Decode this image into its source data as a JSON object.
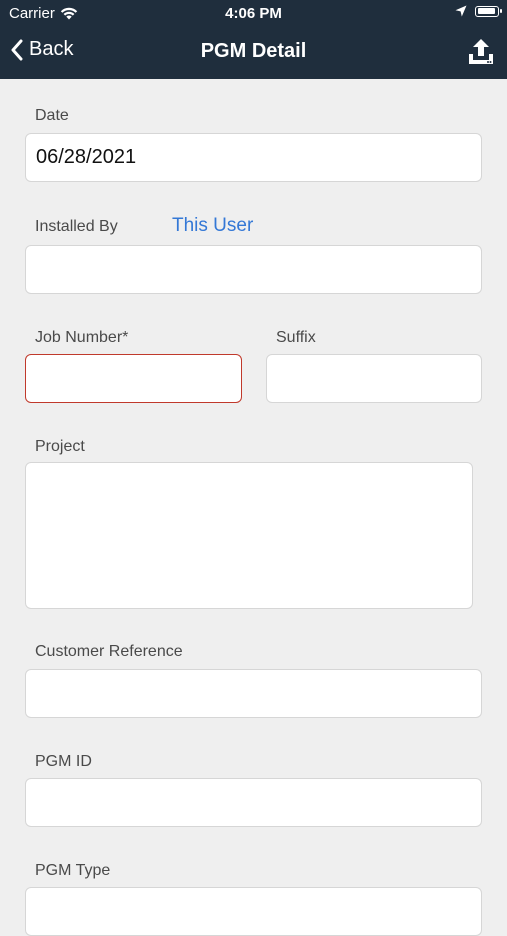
{
  "status_bar": {
    "carrier": "Carrier",
    "time": "4:06 PM",
    "battery_level": 0.95
  },
  "nav": {
    "back_label": "Back",
    "title": "PGM Detail",
    "upload_icon": "upload-icon"
  },
  "form": {
    "date": {
      "label": "Date",
      "value": "06/28/2021"
    },
    "installed_by": {
      "label": "Installed By",
      "link": "This User",
      "value": ""
    },
    "job_number": {
      "label": "Job Number*",
      "value": ""
    },
    "suffix": {
      "label": "Suffix",
      "value": ""
    },
    "project": {
      "label": "Project",
      "value": ""
    },
    "customer_reference": {
      "label": "Customer Reference",
      "value": ""
    },
    "pgm_id": {
      "label": "PGM ID",
      "value": ""
    },
    "pgm_type": {
      "label": "PGM Type",
      "value": ""
    }
  },
  "colors": {
    "nav_background": "#1f2e3d",
    "page_background": "#efefef",
    "link": "#3478d6",
    "error_border": "#c0392b"
  }
}
